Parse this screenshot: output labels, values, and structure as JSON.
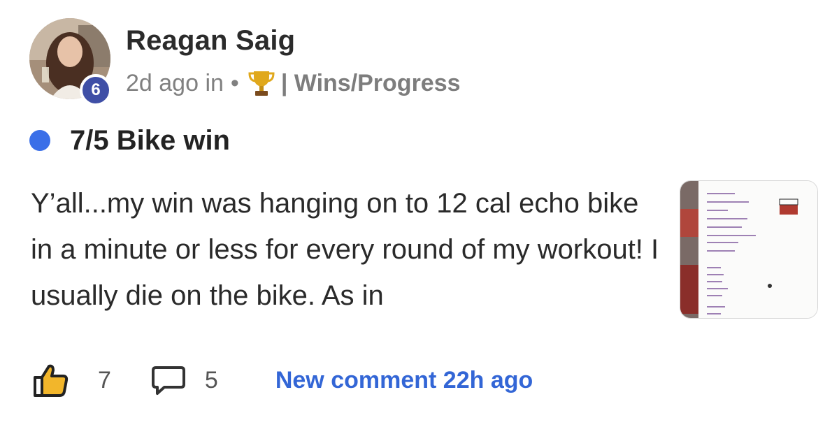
{
  "post": {
    "author": "Reagan Saig",
    "level": "6",
    "time": "2d ago in",
    "separator": "•",
    "category": "| Wins/Progress",
    "category_icon": "trophy-icon",
    "title": "7/5 Bike win",
    "body": "Y’all...my win was hanging on to 12 cal echo bike in a minute or less for every round of my workout! I usually die on the bike. As in",
    "likes": "7",
    "comments": "5",
    "new_comment": "New comment 22h ago"
  },
  "colors": {
    "unread_dot": "#3a6fe8",
    "level_badge": "#3f4fa6",
    "link": "#3366d6",
    "trophy": "#d9a21b"
  }
}
